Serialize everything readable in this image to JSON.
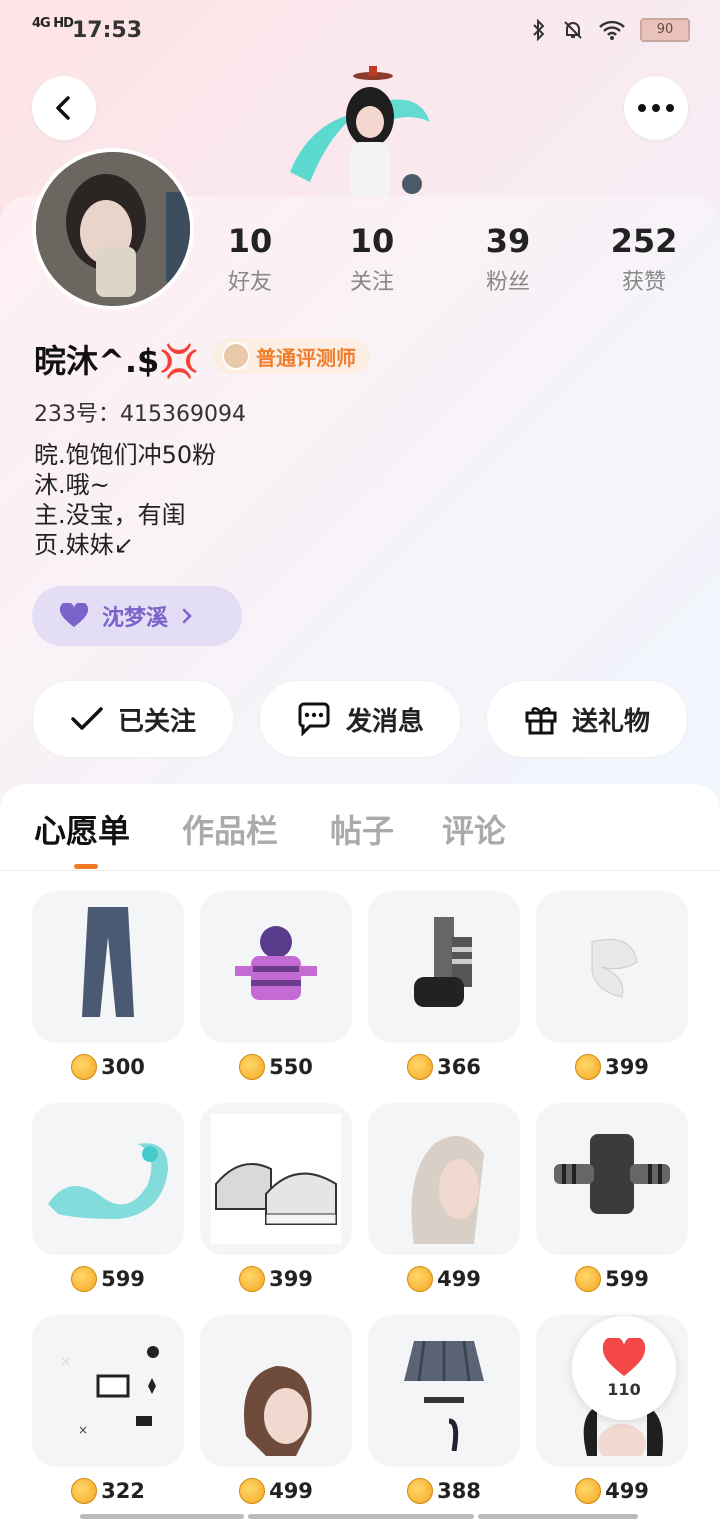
{
  "status": {
    "network": "4G HD",
    "time": "17:53",
    "battery": "90"
  },
  "profile": {
    "stats": [
      {
        "num": "10",
        "label": "好友"
      },
      {
        "num": "10",
        "label": "关注"
      },
      {
        "num": "39",
        "label": "粉丝"
      },
      {
        "num": "252",
        "label": "获赞"
      }
    ],
    "name": "晥沐^.$💢",
    "badge": "普通评测师",
    "uid": "233号：415369094",
    "bio": [
      "晥.饱饱们冲50粉",
      "沐.哦~",
      "主.没宝，有闺",
      "页.妹妹↙"
    ],
    "cp_name": "沈梦溪"
  },
  "actions": {
    "follow": "已关注",
    "message": "发消息",
    "gift": "送礼物"
  },
  "tabs": [
    "心愿单",
    "作品栏",
    "帖子",
    "评论"
  ],
  "items": [
    {
      "price": "300",
      "icon": "jeans"
    },
    {
      "price": "550",
      "icon": "striped-hoodie"
    },
    {
      "price": "366",
      "icon": "boots"
    },
    {
      "price": "399",
      "icon": "white-fur"
    },
    {
      "price": "599",
      "icon": "ice-dragon"
    },
    {
      "price": "399",
      "icon": "sneakers"
    },
    {
      "price": "499",
      "icon": "silver-hair"
    },
    {
      "price": "599",
      "icon": "striped-sweater"
    },
    {
      "price": "322",
      "icon": "pixel-stickers"
    },
    {
      "price": "499",
      "icon": "brown-hair"
    },
    {
      "price": "388",
      "icon": "plaid-skirt"
    },
    {
      "price": "499",
      "icon": "black-hair"
    }
  ],
  "like_count": "110",
  "colors": {
    "accent": "#f07a28",
    "cp_bg": "#e3def5",
    "cp_text": "#7a63c9"
  }
}
